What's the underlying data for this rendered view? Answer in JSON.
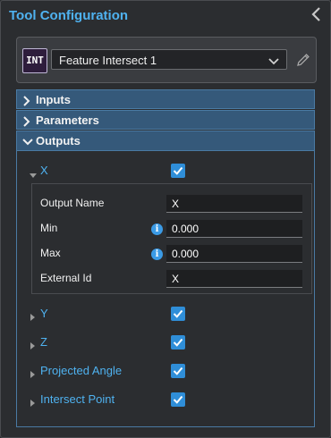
{
  "panel": {
    "title": "Tool Configuration",
    "collapse_icon": "chevron-left-icon"
  },
  "tool": {
    "badge": "INT",
    "selected": "Feature Intersect 1",
    "edit_icon": "pencil-icon"
  },
  "sections": [
    {
      "label": "Inputs",
      "expanded": false
    },
    {
      "label": "Parameters",
      "expanded": false
    },
    {
      "label": "Outputs",
      "expanded": true
    }
  ],
  "outputs": [
    {
      "name": "X",
      "checked": true,
      "expanded": true
    },
    {
      "name": "Y",
      "checked": true,
      "expanded": false
    },
    {
      "name": "Z",
      "checked": true,
      "expanded": false
    },
    {
      "name": "Projected Angle",
      "checked": true,
      "expanded": false
    },
    {
      "name": "Intersect Point",
      "checked": true,
      "expanded": false
    }
  ],
  "x_details": {
    "output_name_label": "Output Name",
    "output_name_value": "X",
    "min_label": "Min",
    "min_value": "0.000",
    "max_label": "Max",
    "max_value": "0.000",
    "external_id_label": "External Id",
    "external_id_value": "X",
    "info_icon": "i"
  },
  "colors": {
    "accent": "#4fb2f0",
    "section_header": "#35597a",
    "checkbox": "#2f8ed8"
  }
}
